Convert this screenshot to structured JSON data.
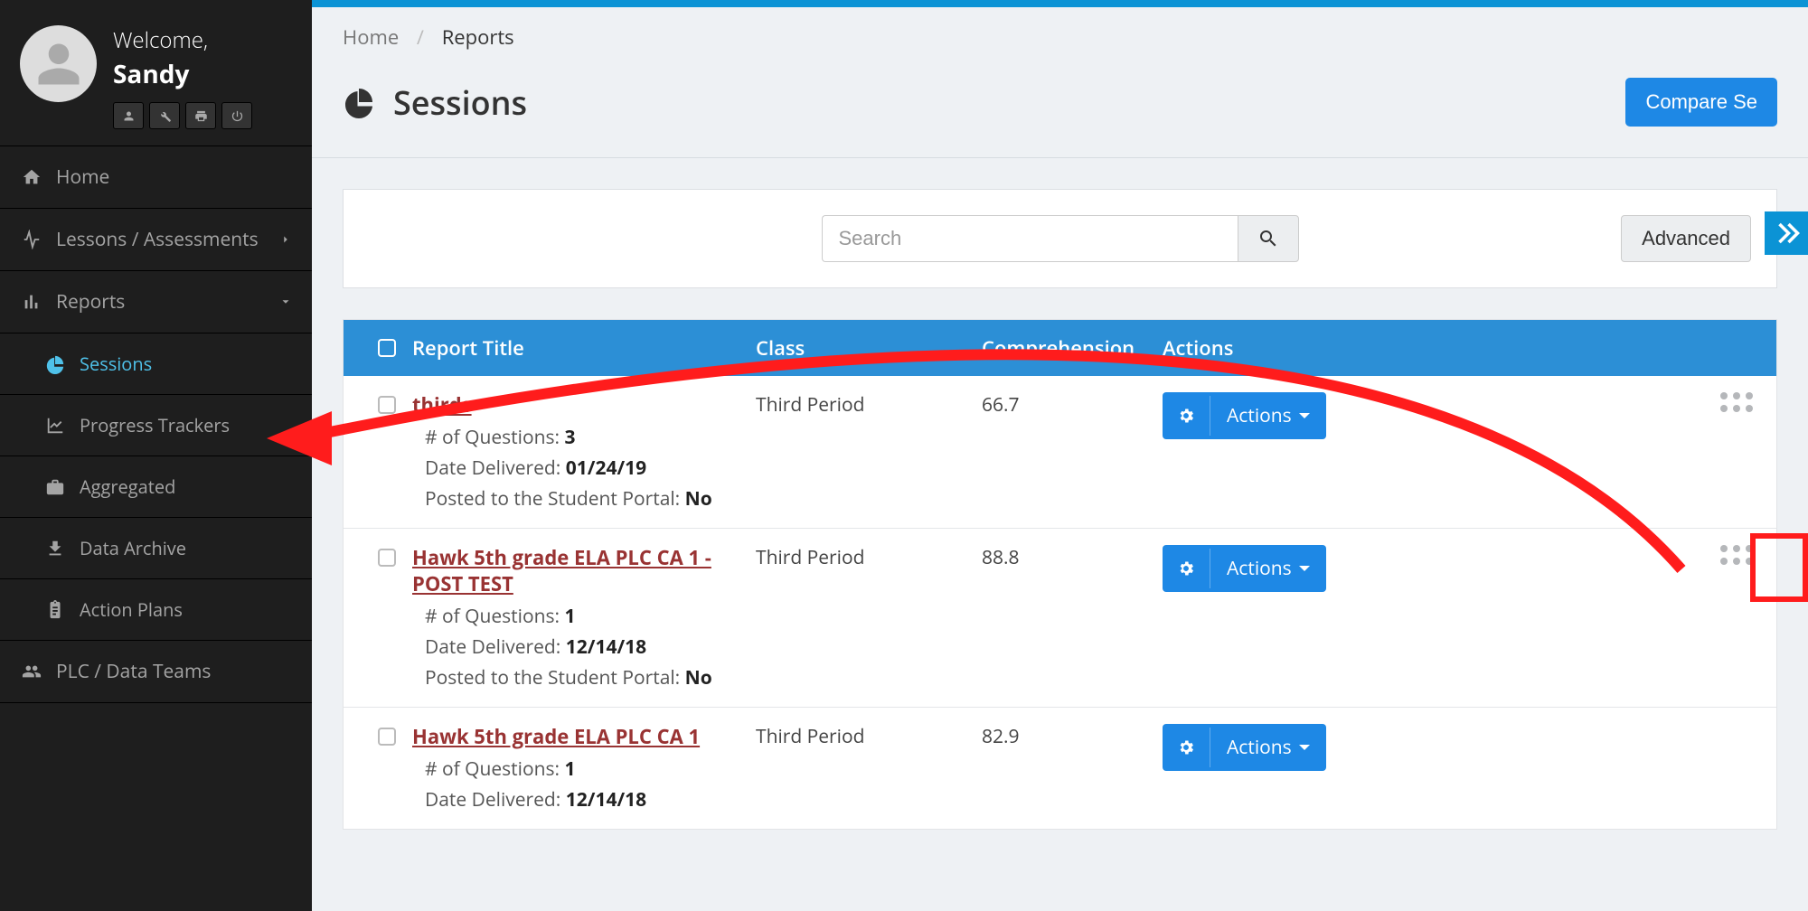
{
  "user": {
    "welcome_label": "Welcome,",
    "name": "Sandy"
  },
  "nav": [
    {
      "label": "Home"
    },
    {
      "label": "Lessons / Assessments"
    },
    {
      "label": "Reports"
    },
    {
      "label": "PLC / Data Teams"
    }
  ],
  "reports_sub": [
    {
      "label": "Sessions"
    },
    {
      "label": "Progress Trackers"
    },
    {
      "label": "Aggregated"
    },
    {
      "label": "Data Archive"
    },
    {
      "label": "Action Plans"
    }
  ],
  "breadcrumb": {
    "home": "Home",
    "current": "Reports"
  },
  "page_title": "Sessions",
  "compare_label": "Compare Se",
  "search": {
    "placeholder": "Search",
    "advanced_label": "Advanced"
  },
  "table": {
    "headers": {
      "title": "Report Title",
      "class": "Class",
      "comp": "Comprehension",
      "actions": "Actions"
    },
    "actions_label": "Actions",
    "meta_labels": {
      "questions": "# of Questions:",
      "delivered": "Date Delivered:",
      "posted": "Posted to the Student Portal:"
    },
    "rows": [
      {
        "title": "thirds",
        "class": "Third Period",
        "comp": "66.7",
        "questions": "3",
        "delivered": "01/24/19",
        "posted": "No"
      },
      {
        "title": "Hawk 5th grade ELA PLC CA 1 - POST TEST",
        "class": "Third Period",
        "comp": "88.8",
        "questions": "1",
        "delivered": "12/14/18",
        "posted": "No"
      },
      {
        "title": "Hawk 5th grade ELA PLC CA 1",
        "class": "Third Period",
        "comp": "82.9",
        "questions": "1",
        "delivered": "12/14/18",
        "posted": null
      }
    ]
  }
}
